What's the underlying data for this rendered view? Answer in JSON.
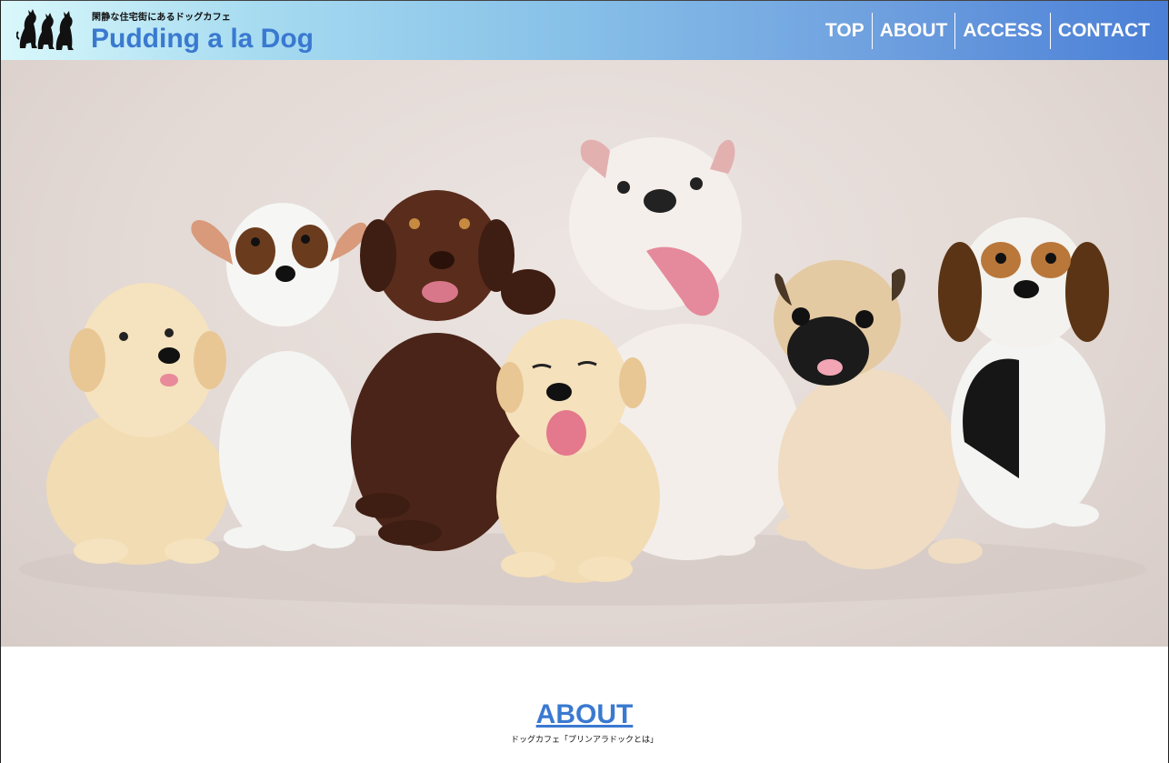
{
  "header": {
    "tagline": "閑静な住宅街にあるドッグカフェ",
    "title": "Pudding a la Dog",
    "logo_icon": "three-dogs-silhouette-icon"
  },
  "nav": {
    "items": [
      {
        "label": "TOP"
      },
      {
        "label": "ABOUT"
      },
      {
        "label": "ACCESS"
      },
      {
        "label": "CONTACT"
      }
    ]
  },
  "hero": {
    "image": "puppies-group-photo"
  },
  "about": {
    "heading": "ABOUT",
    "subtitle": "ドッグカフェ「プリンアラドックとは」"
  },
  "colors": {
    "accent": "#3a79d0",
    "header_gradient_start": "#d9f8fb",
    "header_gradient_end": "#4a7fd6",
    "hero_background": "#e6ddd9"
  }
}
